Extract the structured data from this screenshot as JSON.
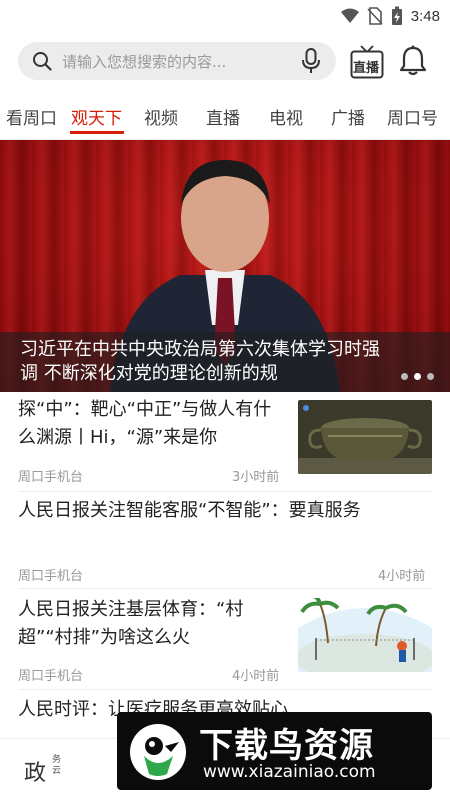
{
  "status_bar": {
    "time": "3:48"
  },
  "search": {
    "placeholder": "请输入您想搜索的内容..."
  },
  "header_actions": {
    "live_label": "直播"
  },
  "tabs": [
    {
      "label": "看周口"
    },
    {
      "label": "观天下"
    },
    {
      "label": "视频"
    },
    {
      "label": "直播"
    },
    {
      "label": "电视"
    },
    {
      "label": "广播"
    },
    {
      "label": "周口号"
    }
  ],
  "active_tab": "观天下",
  "banner": {
    "caption": "习近平在中共中央政治局第六次集体学习时强调 不断深化对党的理论创新的规",
    "dots": [
      {
        "active": false
      },
      {
        "active": true
      },
      {
        "active": false
      }
    ]
  },
  "news": [
    {
      "title": "探“中”：靶心“中正”与做人有什么渊源丨Hi，“源”来是你",
      "source": "周口手机台",
      "time": "3小时前",
      "thumb": "bronze-vessel"
    },
    {
      "title": "人民日报关注智能客服“不智能”：要真服务",
      "source": "周口手机台",
      "time": "4小时前"
    },
    {
      "title": "人民日报关注基层体育：“村超”“村排”为啥这么火",
      "source": "周口手机台",
      "time": "4小时前",
      "thumb": "beach-volleyball"
    },
    {
      "title": "人民时评：让医疗服务更高效贴心"
    }
  ],
  "bottom_bar": {
    "label": "政",
    "sub_label": "务云"
  },
  "watermark": {
    "title": "下载鸟资源",
    "url": "www.xiazainiao.com"
  },
  "colors": {
    "accent": "#d81e06",
    "banner_red": "#b50e12"
  }
}
